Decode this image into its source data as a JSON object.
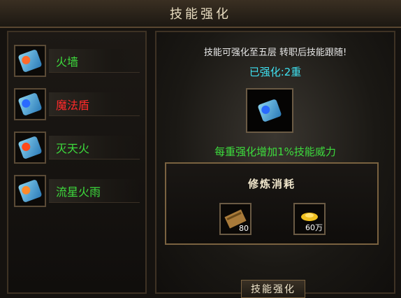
{
  "title": "技能强化",
  "skills": [
    {
      "name": "火墙",
      "color": "#3ddc3d"
    },
    {
      "name": "魔法盾",
      "color": "#ff2a2a"
    },
    {
      "name": "灭天火",
      "color": "#3ddc3d"
    },
    {
      "name": "流星火雨",
      "color": "#3ddc3d"
    }
  ],
  "info": {
    "notice": "技能可强化至五层 转职后技能跟随!",
    "level": "已强化:2重",
    "effect": "每重强化增加1%技能威力"
  },
  "cost": {
    "title": "修炼消耗",
    "items": [
      {
        "icon": "scroll-icon",
        "qty": "80"
      },
      {
        "icon": "gold-ingot-icon",
        "qty": "60万"
      }
    ]
  },
  "button": "技能强化"
}
